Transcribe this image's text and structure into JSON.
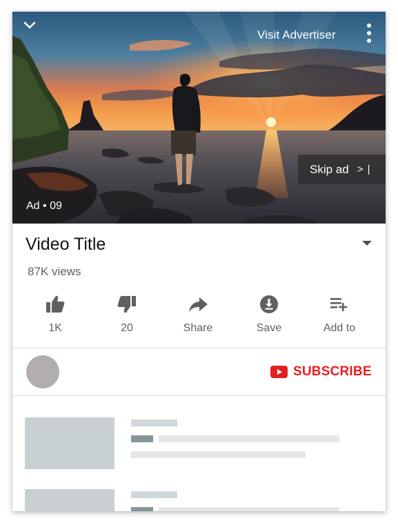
{
  "player": {
    "visit_advertiser": "Visit Advertiser",
    "skip_label": "Skip ad",
    "skip_arrow": "> |",
    "ad_label": "Ad • 09",
    "collapse_icon": "chevron-down-icon",
    "more_icon": "more-vertical-icon"
  },
  "video": {
    "title": "Video Title",
    "views": "87K views",
    "expand_icon": "caret-down-icon"
  },
  "actions": [
    {
      "icon": "thumb-up-icon",
      "label": "1K"
    },
    {
      "icon": "thumb-down-icon",
      "label": "20"
    },
    {
      "icon": "share-icon",
      "label": "Share"
    },
    {
      "icon": "download-icon",
      "label": "Save"
    },
    {
      "icon": "playlist-add-icon",
      "label": "Add to"
    }
  ],
  "channel": {
    "subscribe_label": "SUBSCRIBE",
    "subscribe_color": "#e32020"
  },
  "colors": {
    "placeholder_thumb": "#c8d0d2",
    "placeholder_bar": "#e6e6e6",
    "placeholder_accent": "#86959a"
  }
}
